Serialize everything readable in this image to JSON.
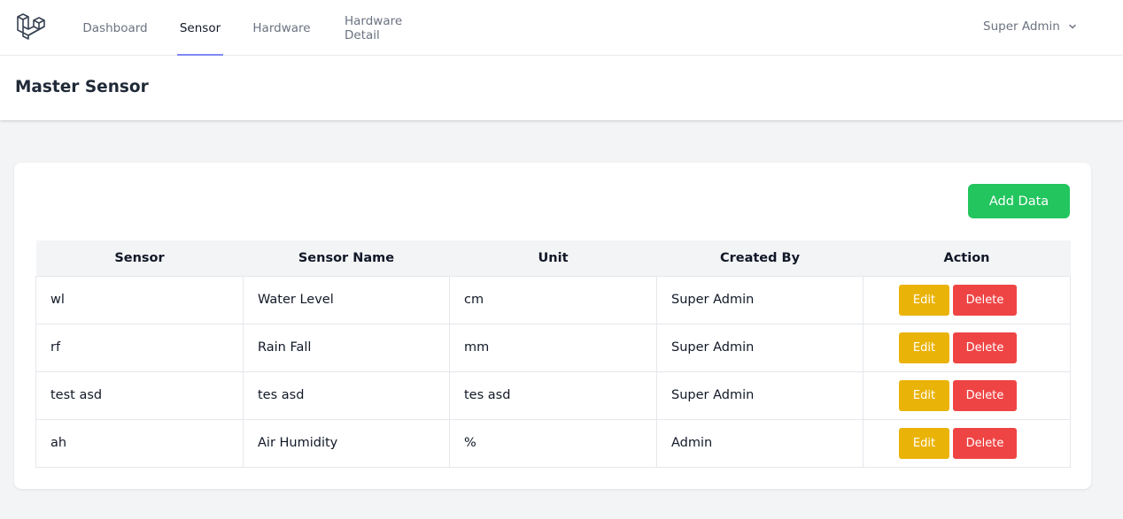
{
  "nav": {
    "items": [
      {
        "label": "Dashboard"
      },
      {
        "label": "Sensor"
      },
      {
        "label": "Hardware"
      },
      {
        "label": "Hardware Detail"
      }
    ],
    "active": "Sensor",
    "user_name": "Super Admin"
  },
  "header": {
    "title": "Master Sensor"
  },
  "toolbar": {
    "add_label": "Add Data"
  },
  "table": {
    "columns": [
      "Sensor",
      "Sensor Name",
      "Unit",
      "Created By",
      "Action"
    ],
    "rows": [
      {
        "sensor": "wl",
        "name": "Water Level",
        "unit": "cm",
        "created_by": "Super Admin"
      },
      {
        "sensor": "rf",
        "name": "Rain Fall",
        "unit": "mm",
        "created_by": "Super Admin"
      },
      {
        "sensor": "test asd",
        "name": "tes asd",
        "unit": "tes asd",
        "created_by": "Super Admin"
      },
      {
        "sensor": "ah",
        "name": "Air Humidity",
        "unit": "%",
        "created_by": "Admin"
      }
    ],
    "edit_label": "Edit",
    "delete_label": "Delete"
  },
  "colors": {
    "accent": "#818cf8",
    "add_button": "#22c55e",
    "edit_button": "#eab308",
    "delete_button": "#ef4444"
  }
}
